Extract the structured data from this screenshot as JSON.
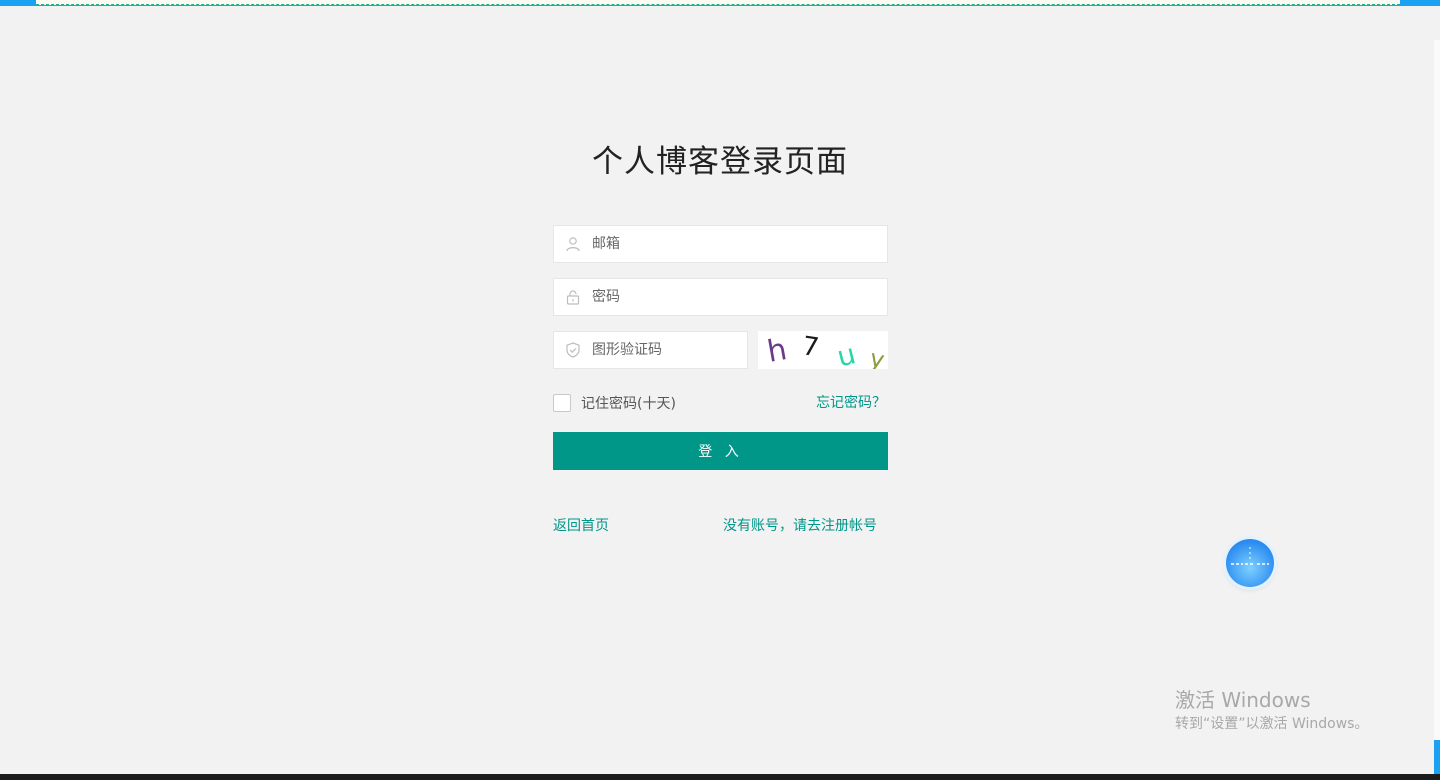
{
  "page": {
    "title": "个人博客登录页面"
  },
  "form": {
    "email_placeholder": "邮箱",
    "password_placeholder": "密码",
    "captcha_placeholder": "图形验证码",
    "captcha_text": "h7 uy",
    "remember_label": "记住密码(十天)",
    "forgot_label": "忘记密码？",
    "login_label": "登 入"
  },
  "links": {
    "home": "返回首页",
    "register": "没有账号，请去注册帐号"
  },
  "windows": {
    "activate_title": "激活 Windows",
    "activate_hint": "转到“设置”以激活 Windows。"
  },
  "colors": {
    "accent": "#009688",
    "background": "#f2f2f2"
  }
}
